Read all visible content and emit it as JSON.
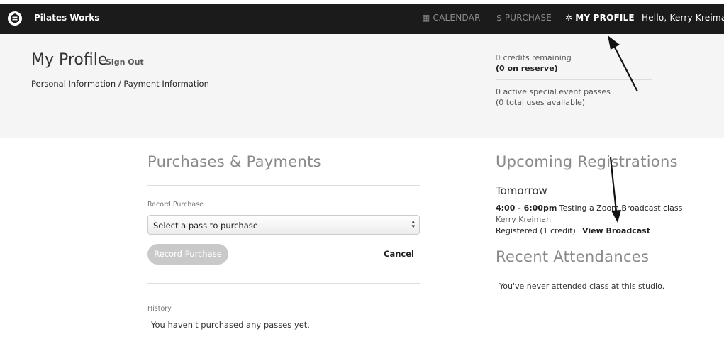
{
  "nav": {
    "brand": "Pilates Works",
    "logo_icon": "pilates-logo-icon",
    "items": [
      {
        "icon": "calendar-icon",
        "glyph": "▦",
        "label": "CALENDAR"
      },
      {
        "icon": "dollar-icon",
        "glyph": "$",
        "label": "PURCHASE"
      },
      {
        "icon": "gear-icon",
        "glyph": "✲",
        "label": "MY PROFILE",
        "active": true
      }
    ],
    "greeting": "Hello, Kerry Kreiman"
  },
  "profile": {
    "title": "My Profile",
    "sign_out": "Sign Out",
    "tabs": [
      "Personal Information",
      "Payment Information"
    ],
    "tab_separator": " / ",
    "credits_count": "0",
    "credits_text": " credits remaining",
    "reserve_text": "(0 on reserve)",
    "passes_text": "0 active special event passes",
    "passes_uses": "(0 total uses available)"
  },
  "purchases": {
    "title": "Purchases & Payments",
    "record_label": "Record Purchase",
    "select_value": "Select a pass to purchase",
    "record_button": "Record Purchase",
    "cancel": "Cancel",
    "history_label": "History",
    "history_empty": "You haven't purchased any passes yet."
  },
  "registrations": {
    "title": "Upcoming Registrations",
    "day": "Tomorrow",
    "time": "4:00 - 6:00pm",
    "class_name": " Testing a Zoom Broadcast class",
    "instructor": "Kerry Kreiman",
    "status": "Registered (1 credit)",
    "view_broadcast": "View Broadcast"
  },
  "attendances": {
    "title": "Recent Attendances",
    "empty": "You've never attended class at this studio."
  },
  "colors": {
    "topbar": "#1b1b1b",
    "band": "#f5f5f5",
    "muted_heading": "#8a8a8a",
    "disabled_button": "#c9c9c9"
  }
}
